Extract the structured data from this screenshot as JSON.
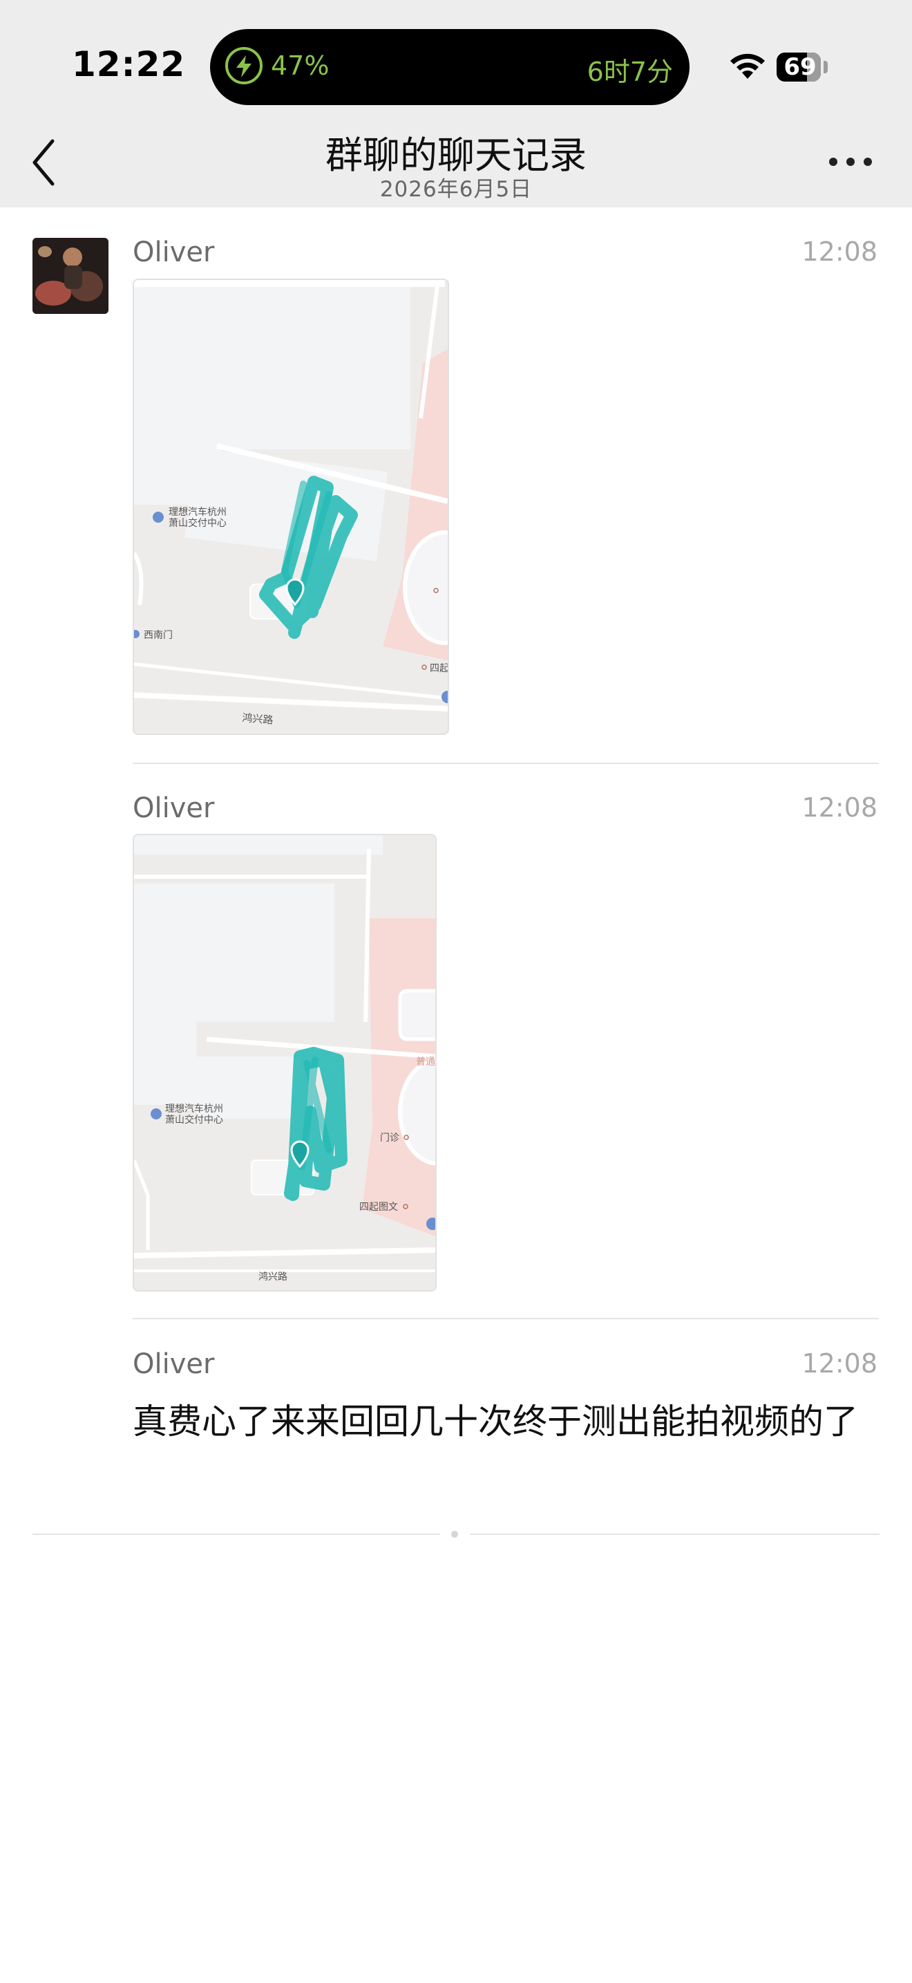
{
  "status_bar": {
    "time": "12:22",
    "island_percent": "47%",
    "island_right": "6时7分",
    "battery": "69"
  },
  "nav": {
    "title": "群聊的聊天记录",
    "subtitle": "2026年6月5日"
  },
  "messages": [
    {
      "sender": "Oliver",
      "time": "12:08",
      "type": "image",
      "map_labels": {
        "poi": "理想汽车杭州",
        "poi2": "萧山交付中心",
        "gate": "西南门",
        "road": "鸿兴路",
        "corner": "四起"
      }
    },
    {
      "sender": "Oliver",
      "time": "12:08",
      "type": "image",
      "map_labels": {
        "poi": "理想汽车杭州",
        "poi2": "萧山交付中心",
        "clinic": "门诊",
        "shop": "四起图文",
        "road": "鸿兴路",
        "top": "普通"
      }
    },
    {
      "sender": "Oliver",
      "time": "12:08",
      "type": "text",
      "text": "真费心了来来回回几十次终于测出能拍视频的了"
    }
  ],
  "colors": {
    "route": "#1fb8b4",
    "accent_green": "#8bc34a",
    "background": "#ededed"
  }
}
